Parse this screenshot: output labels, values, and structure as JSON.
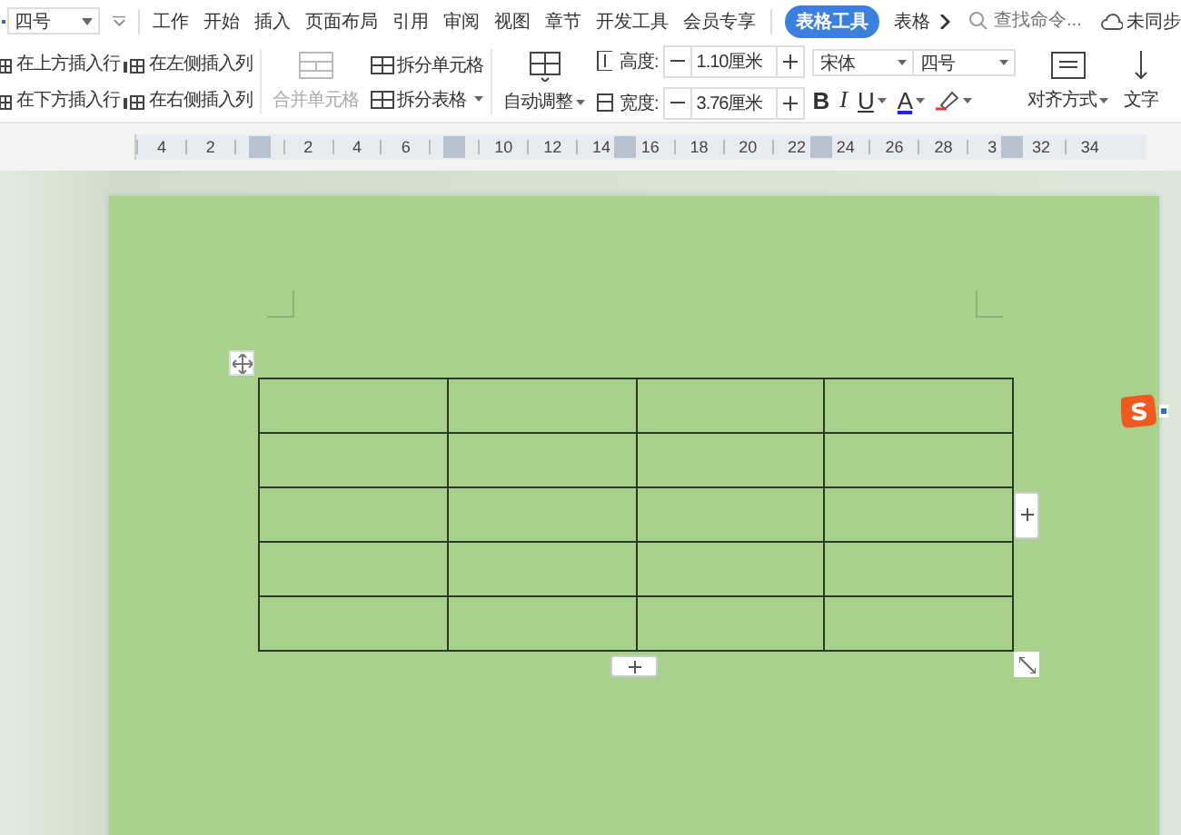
{
  "menu_bar": {
    "font_size_select": "四号",
    "menus": [
      {
        "label": "工作",
        "selected": false
      },
      {
        "label": "开始",
        "selected": false
      },
      {
        "label": "插入",
        "selected": false
      },
      {
        "label": "页面布局",
        "selected": false
      },
      {
        "label": "引用",
        "selected": false
      },
      {
        "label": "审阅",
        "selected": false
      },
      {
        "label": "视图",
        "selected": false
      },
      {
        "label": "章节",
        "selected": false
      },
      {
        "label": "开发工具",
        "selected": false
      },
      {
        "label": "会员专享",
        "selected": false
      },
      {
        "label": "表格工具",
        "selected": true
      },
      {
        "label": "表格",
        "selected": false
      }
    ],
    "search": {
      "placeholder": "查找命令..."
    },
    "sync": "未同步"
  },
  "ribbon": {
    "insert": [
      {
        "label": "在上方插入行",
        "kind": "row-above"
      },
      {
        "label": "在下方插入行",
        "kind": "row-below"
      },
      {
        "label": "在左侧插入列",
        "kind": "col-left"
      },
      {
        "label": "在右侧插入列",
        "kind": "col-right"
      }
    ],
    "merge": {
      "label": "合并单元格",
      "disabled": true
    },
    "split": [
      {
        "label": "拆分单元格",
        "dropdown": false
      },
      {
        "label": "拆分表格",
        "dropdown": true
      }
    ],
    "autofit": {
      "label": "自动调整"
    },
    "sizes": [
      {
        "label": "高度:",
        "value": "1.10厘米",
        "kind": "height"
      },
      {
        "label": "宽度:",
        "value": "3.76厘米",
        "kind": "width"
      }
    ],
    "font": {
      "family": "宋体",
      "size": "四号"
    },
    "format_buttons": [
      {
        "label": "B",
        "kind": "bold",
        "dropdown": false
      },
      {
        "label": "I",
        "kind": "italic",
        "dropdown": false
      },
      {
        "label": "U",
        "kind": "underline",
        "dropdown": true
      },
      {
        "label": "A",
        "kind": "color",
        "dropdown": true
      },
      {
        "kind": "highlight",
        "dropdown": true
      }
    ],
    "align": {
      "label": "对齐方式"
    },
    "text_direction": {
      "label": "文字"
    }
  },
  "ruler": [
    {
      "label": "4"
    },
    {
      "label": "2"
    },
    {
      "kind": "marker"
    },
    {
      "label": "2"
    },
    {
      "label": "4"
    },
    {
      "label": "6"
    },
    {
      "kind": "marker"
    },
    {
      "label": "10"
    },
    {
      "label": "12"
    },
    {
      "label": "14"
    },
    {
      "label": "16"
    },
    {
      "label": "18"
    },
    {
      "label": "20"
    },
    {
      "label": "22"
    },
    {
      "label": "24"
    },
    {
      "label": "26"
    },
    {
      "label": "28"
    },
    {
      "label": "3"
    },
    {
      "label": "32"
    },
    {
      "label": "34"
    }
  ],
  "table": {
    "rows": [
      {
        "cells": [
          {
            "kind": "empty"
          },
          {
            "kind": "empty"
          },
          {
            "kind": "empty"
          },
          {
            "kind": "empty"
          }
        ]
      },
      {
        "cells": [
          {
            "kind": "empty"
          },
          {
            "kind": "empty"
          },
          {
            "kind": "empty"
          },
          {
            "kind": "empty"
          }
        ]
      },
      {
        "cells": [
          {
            "kind": "empty"
          },
          {
            "kind": "empty"
          },
          {
            "kind": "empty"
          },
          {
            "kind": "empty"
          }
        ]
      },
      {
        "cells": [
          {
            "kind": "empty"
          },
          {
            "kind": "empty"
          },
          {
            "kind": "empty"
          },
          {
            "kind": "empty"
          }
        ]
      },
      {
        "cells": [
          {
            "kind": "empty"
          },
          {
            "kind": "empty"
          },
          {
            "kind": "empty"
          },
          {
            "kind": "empty"
          }
        ]
      }
    ]
  }
}
